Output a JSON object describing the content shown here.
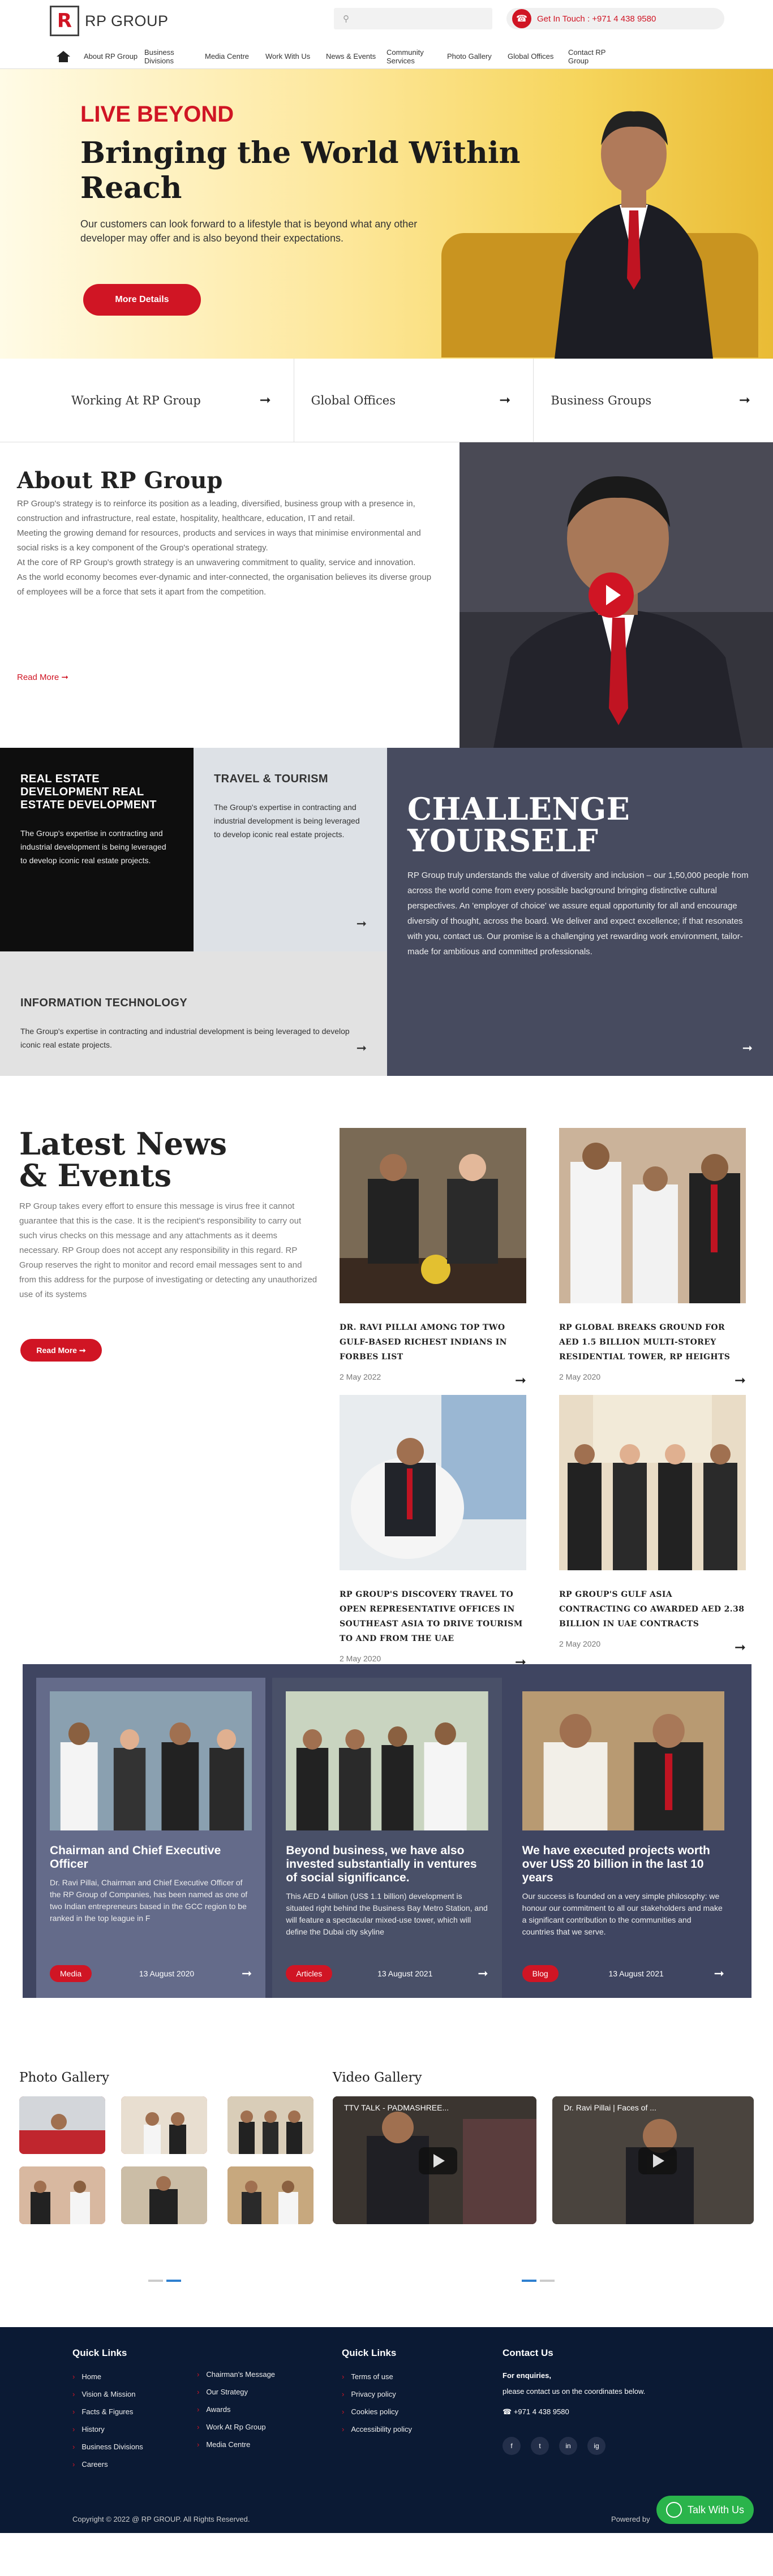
{
  "header": {
    "logo_letter": "R",
    "logo_text": "RP GROUP",
    "search_placeholder": "",
    "get_in_touch": "Get In Touch : +971 4 438 9580"
  },
  "nav": [
    "About RP Group",
    "Business Divisions",
    "Media Centre",
    "Work With Us",
    "News & Events",
    "Community Services",
    "Photo Gallery",
    "Global Offices",
    "Contact RP Group"
  ],
  "hero": {
    "kicker": "LIVE BEYOND",
    "title": "Bringing the World Within Reach",
    "text": "Our customers can look forward to a lifestyle that is beyond what any other developer may offer and is also beyond their expectations.",
    "button": "More Details"
  },
  "quick_links": [
    "Working At RP Group",
    "Global Offices",
    "Business Groups"
  ],
  "about": {
    "title": "About RP Group",
    "paragraphs": [
      "RP Group's strategy is to reinforce its position as a leading, diversified, business group with a presence in, construction and infrastructure, real estate, hospitality, healthcare, education, IT and retail.",
      "Meeting the growing demand for resources, products and services in ways that minimise environmental and social risks is a key component of the Group's operational strategy.",
      "At the core of RP Group's growth strategy is an unwavering commitment to quality, service and innovation.",
      "As the world economy becomes ever-dynamic and inter-connected, the organisation believes its diverse group of employees will be a force that sets it apart from the competition."
    ],
    "read_more": "Read More ➞"
  },
  "tiles": {
    "t1": {
      "title": "REAL ESTATE DEVELOPMENT REAL ESTATE DEVELOPMENT",
      "text": "The Group's expertise in contracting and industrial development is being leveraged to develop iconic real estate projects."
    },
    "t2": {
      "title": "TRAVEL & TOURISM",
      "text": "The Group's expertise in contracting and industrial development is being leveraged to develop iconic real estate projects."
    },
    "t3": {
      "title": "INFORMATION TECHNOLOGY",
      "text": "The Group's expertise in contracting and industrial development is being leveraged to develop iconic real estate projects."
    },
    "t4": {
      "title": "CHALLENGE YOURSELF",
      "text": "RP Group truly understands the value of diversity and inclusion – our 1,50,000 people from across the world come from every possible background bringing distinctive cultural perspectives. An 'employer of choice' we assure equal opportunity for all and encourage diversity of thought, across the board. We deliver and expect excellence; if that resonates with you, contact us. Our promise is a challenging yet rewarding work environment, tailor-made for ambitious and committed professionals."
    }
  },
  "news": {
    "title": "Latest News & Events",
    "text": "RP Group takes every effort to ensure this message is virus free it cannot guarantee that this is the case. It is the recipient's responsibility to carry out such virus checks on this message and any attachments as it deems necessary. RP Group does not accept any responsibility in this regard. RP Group reserves the right to monitor and record email messages sent to and from this address for the purpose of investigating or detecting any unauthorized use of its systems",
    "button": "Read More ➞",
    "items": [
      {
        "title": "DR. RAVI PILLAI AMONG TOP TWO GULF-BASED RICHEST INDIANS IN FORBES LIST",
        "date": "2 May 2022"
      },
      {
        "title": "RP GLOBAL BREAKS GROUND FOR AED 1.5 BILLION MULTI-STOREY RESIDENTIAL TOWER, RP HEIGHTS",
        "date": "2 May 2020"
      },
      {
        "title": "RP GROUP'S DISCOVERY TRAVEL TO OPEN REPRESENTATIVE OFFICES IN SOUTHEAST ASIA TO DRIVE TOURISM TO AND FROM THE UAE",
        "date": "2 May 2020"
      },
      {
        "title": "RP GROUP'S GULF ASIA CONTRACTING CO AWARDED AED 2.38 BILLION IN UAE CONTRACTS",
        "date": "2 May 2020"
      }
    ]
  },
  "features": [
    {
      "title": "Chairman and Chief Executive Officer",
      "text": "Dr. Ravi Pillai, Chairman and Chief Executive Officer of the RP Group of Companies, has been named as one of two Indian entrepreneurs based in the GCC region to be ranked in the top league in F",
      "tag": "Media",
      "date": "13 August 2020"
    },
    {
      "title": "Beyond business, we have also invested substantially in ventures of social significance.",
      "text": "This AED 4 billion (US$ 1.1 billion) development is situated right behind the Business Bay Metro Station, and will feature a spectacular mixed-use tower, which will define the Dubai city skyline",
      "tag": "Articles",
      "date": "13 August 2021"
    },
    {
      "title": "We have executed projects worth over US$ 20 billion in the last 10 years",
      "text": "Our success is founded on a very simple philosophy: we honour our commitment to all our stakeholders and make a significant contribution to the communities and countries that we serve.",
      "tag": "Blog",
      "date": "13 August 2021"
    }
  ],
  "gallery": {
    "photo_title": "Photo Gallery",
    "video_title": "Video Gallery",
    "videos": [
      "TTV TALK - PADMASHREE...",
      "Dr. Ravi Pillai | Faces of ..."
    ]
  },
  "footer": {
    "col1_title": "Quick Links",
    "col1": [
      "Home",
      "Vision & Mission",
      "Facts & Figures",
      "History",
      "Business Divisions",
      "Careers"
    ],
    "col2": [
      "Chairman's Message",
      "Our Strategy",
      "Awards",
      "Work At Rp Group",
      "Media Centre"
    ],
    "col3_title": "Quick Links",
    "col3": [
      "Terms of use",
      "Privacy policy",
      "Cookies policy",
      "Accessibility policy"
    ],
    "contact_title": "Contact Us",
    "contact_line1": "For enquiries,",
    "contact_line2": "please contact us on the coordinates below.",
    "phone": "+971 4 438 9580",
    "social": [
      "f",
      "t",
      "in",
      "ig"
    ],
    "copyright": "Copyright © 2022 @ RP GROUP. All Rights Reserved.",
    "powered": "Powered by",
    "whatsapp": "Talk With Us"
  },
  "colors": {
    "accent": "#d01524",
    "footer": "#0b1a34",
    "feature_bg": "#3f4561"
  }
}
